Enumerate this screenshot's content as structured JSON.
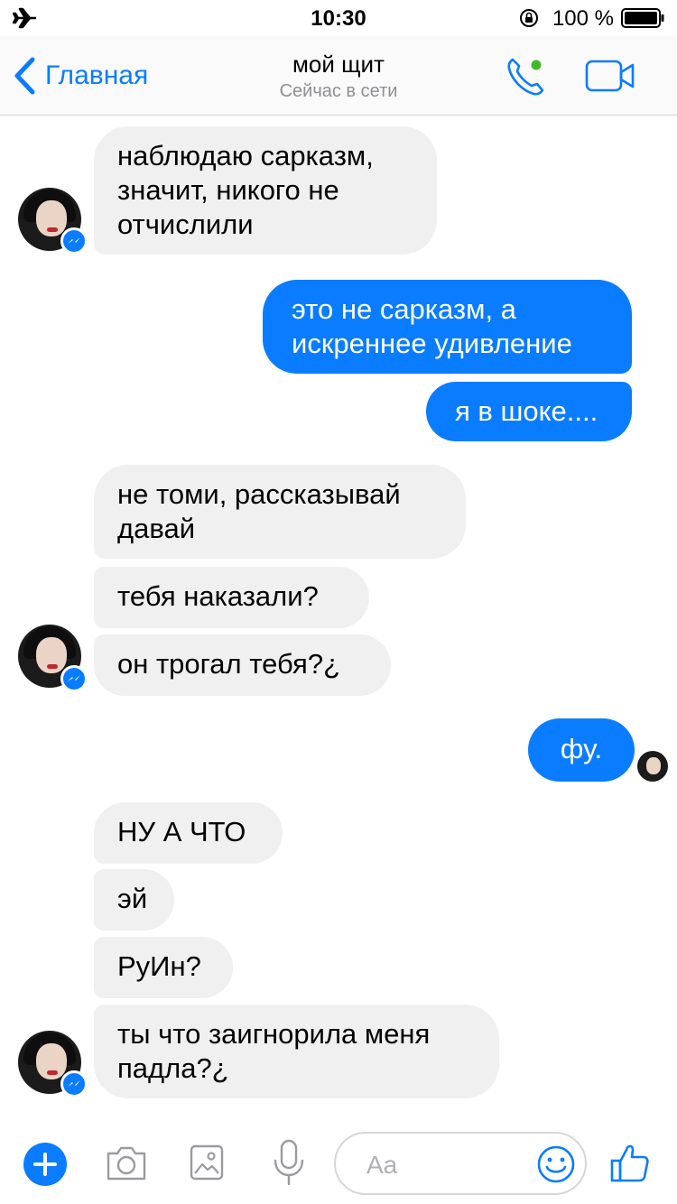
{
  "status_bar": {
    "time": "10:30",
    "battery_percent": "100 %"
  },
  "header": {
    "back_label": "Главная",
    "title": "мой щит",
    "subtitle": "Сейчас в сети"
  },
  "messages": [
    {
      "from": "them",
      "text": "наблюдаю сарказм, значит, никого не отчислили"
    },
    {
      "from": "me",
      "text": "это не сарказм, а искреннее удивление"
    },
    {
      "from": "me",
      "text": "я в шоке...."
    },
    {
      "from": "them",
      "text": "не томи, рассказывай давай"
    },
    {
      "from": "them",
      "text": "тебя наказали?"
    },
    {
      "from": "them",
      "text": "он трогал тебя?¿"
    },
    {
      "from": "me",
      "text": "фу."
    },
    {
      "from": "them",
      "text": "НУ А ЧТО"
    },
    {
      "from": "them",
      "text": "эй"
    },
    {
      "from": "them",
      "text": "РуИн?"
    },
    {
      "from": "them",
      "text": "ты что заигнорила меня падла?¿"
    }
  ],
  "composer": {
    "placeholder": "Aa"
  },
  "colors": {
    "accent": "#0a7cff",
    "incoming_bubble": "#f0f0f0",
    "outgoing_text": "#ffffff"
  },
  "icons": [
    "airplane-icon",
    "rotation-lock-icon",
    "battery-icon",
    "chevron-left-icon",
    "phone-icon",
    "online-dot-icon",
    "video-camera-icon",
    "messenger-icon",
    "plus-icon",
    "camera-icon",
    "photo-icon",
    "microphone-icon",
    "emoji-icon",
    "thumbs-up-icon"
  ]
}
